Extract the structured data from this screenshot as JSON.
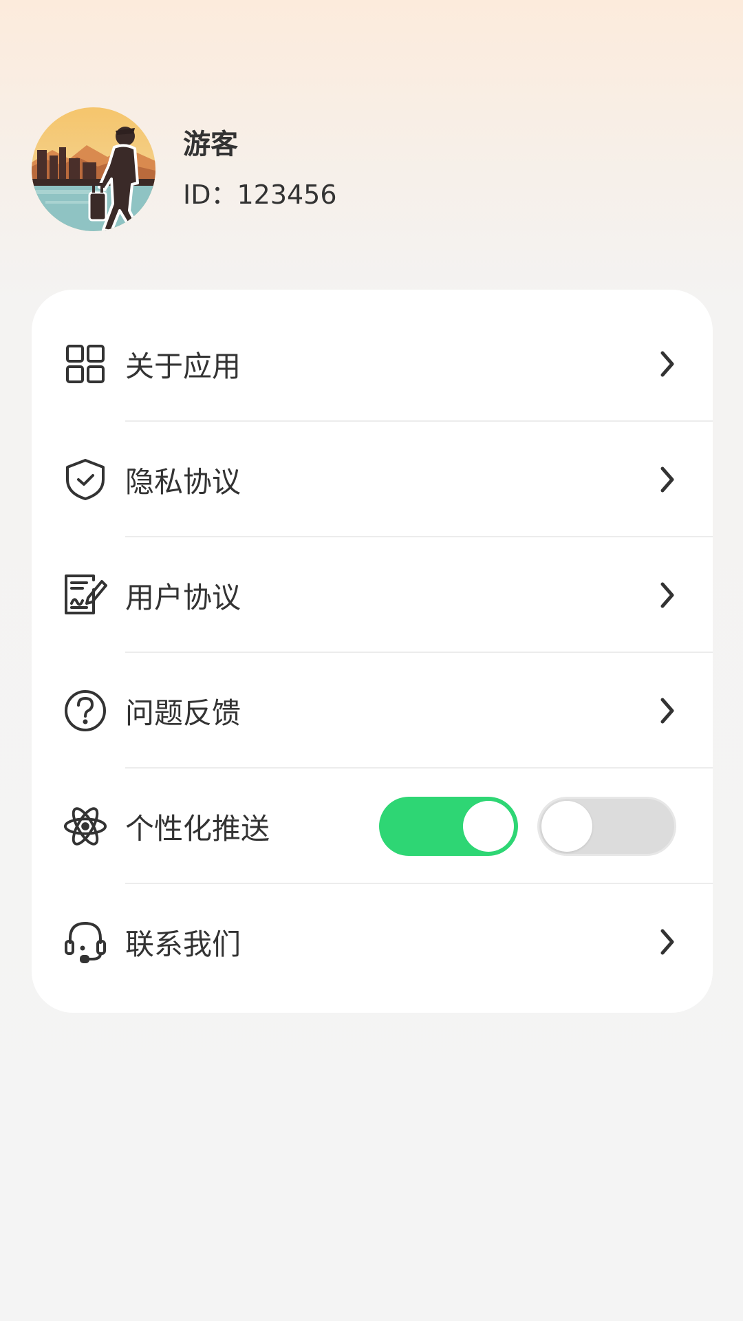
{
  "profile": {
    "name": "游客",
    "id_text": "ID：123456"
  },
  "menu": {
    "items": [
      {
        "label": "关于应用",
        "icon": "apps-grid-icon"
      },
      {
        "label": "隐私协议",
        "icon": "shield-check-icon"
      },
      {
        "label": "用户协议",
        "icon": "document-edit-icon"
      },
      {
        "label": "问题反馈",
        "icon": "question-circle-icon"
      },
      {
        "label": "个性化推送",
        "icon": "atom-icon"
      },
      {
        "label": "联系我们",
        "icon": "headset-icon"
      }
    ]
  },
  "personalized_push": {
    "toggle_1": "on",
    "toggle_2": "off"
  },
  "colors": {
    "toggle_on": "#2ed674",
    "toggle_off": "#dcdcdc",
    "text": "#333333"
  }
}
